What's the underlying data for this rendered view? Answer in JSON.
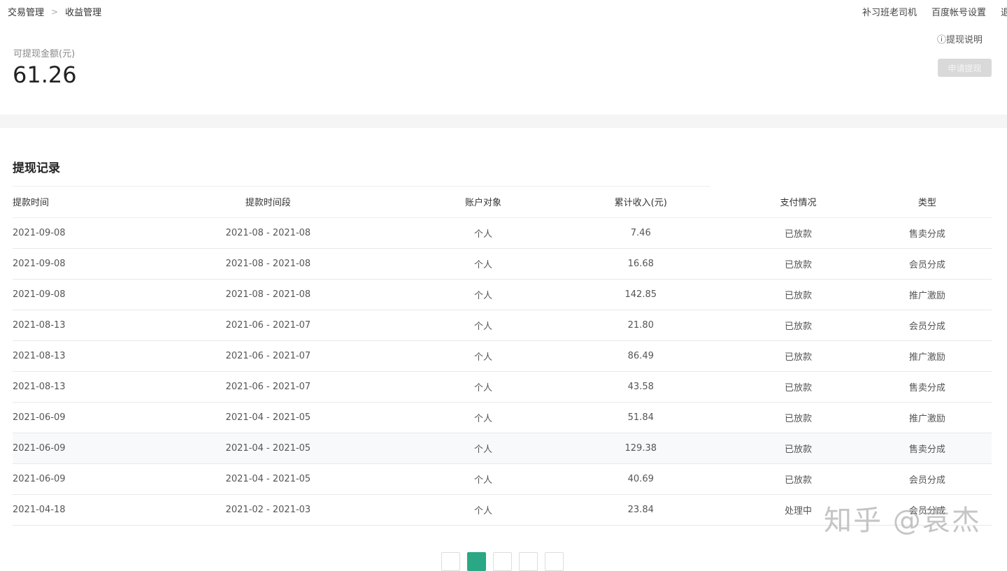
{
  "breadcrumb": [
    "交易管理",
    "收益管理"
  ],
  "topnav": [
    "补习班老司机",
    "百度帐号设置",
    "退"
  ],
  "summary": {
    "label": "可提现金额(元)",
    "value": "61.26",
    "help": "ⓘ提现说明",
    "apply": "申请提现"
  },
  "records": {
    "title": "提现记录",
    "headers": [
      "提款时间",
      "提款时间段",
      "账户对象",
      "累计收入(元)",
      "支付情况",
      "类型"
    ],
    "rows": [
      [
        "2021-09-08",
        "2021-08 - 2021-08",
        "个人",
        "7.46",
        "已放款",
        "售卖分成"
      ],
      [
        "2021-09-08",
        "2021-08 - 2021-08",
        "个人",
        "16.68",
        "已放款",
        "会员分成"
      ],
      [
        "2021-09-08",
        "2021-08 - 2021-08",
        "个人",
        "142.85",
        "已放款",
        "推广激励"
      ],
      [
        "2021-08-13",
        "2021-06 - 2021-07",
        "个人",
        "21.80",
        "已放款",
        "会员分成"
      ],
      [
        "2021-08-13",
        "2021-06 - 2021-07",
        "个人",
        "86.49",
        "已放款",
        "推广激励"
      ],
      [
        "2021-08-13",
        "2021-06 - 2021-07",
        "个人",
        "43.58",
        "已放款",
        "售卖分成"
      ],
      [
        "2021-06-09",
        "2021-04 - 2021-05",
        "个人",
        "51.84",
        "已放款",
        "推广激励"
      ],
      [
        "2021-06-09",
        "2021-04 - 2021-05",
        "个人",
        "129.38",
        "已放款",
        "售卖分成"
      ],
      [
        "2021-06-09",
        "2021-04 - 2021-05",
        "个人",
        "40.69",
        "已放款",
        "会员分成"
      ],
      [
        "2021-04-18",
        "2021-02 - 2021-03",
        "个人",
        "23.84",
        "处理中",
        "会员分成"
      ]
    ]
  },
  "watermark": "知乎 @袁杰",
  "colors": {
    "accent": "#2aa784"
  }
}
